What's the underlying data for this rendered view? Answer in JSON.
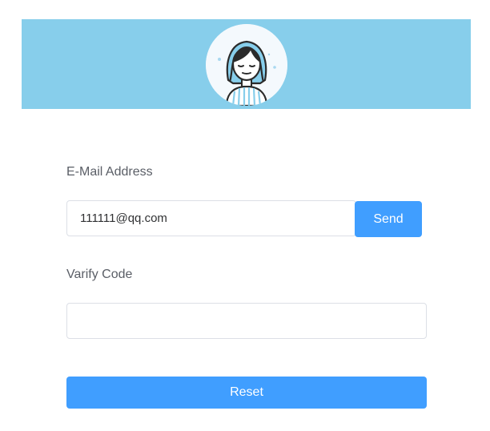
{
  "header": {
    "avatar_icon": "woman-avatar-icon",
    "banner_color": "#87ceeb"
  },
  "form": {
    "email_label": "E-Mail Address",
    "email_value": "111111@qq.com",
    "send_label": "Send",
    "code_label": "Varify Code",
    "code_value": "",
    "reset_label": "Reset"
  },
  "colors": {
    "primary": "#409eff",
    "label_text": "#5a5e66",
    "input_border": "#dcdfe6"
  }
}
